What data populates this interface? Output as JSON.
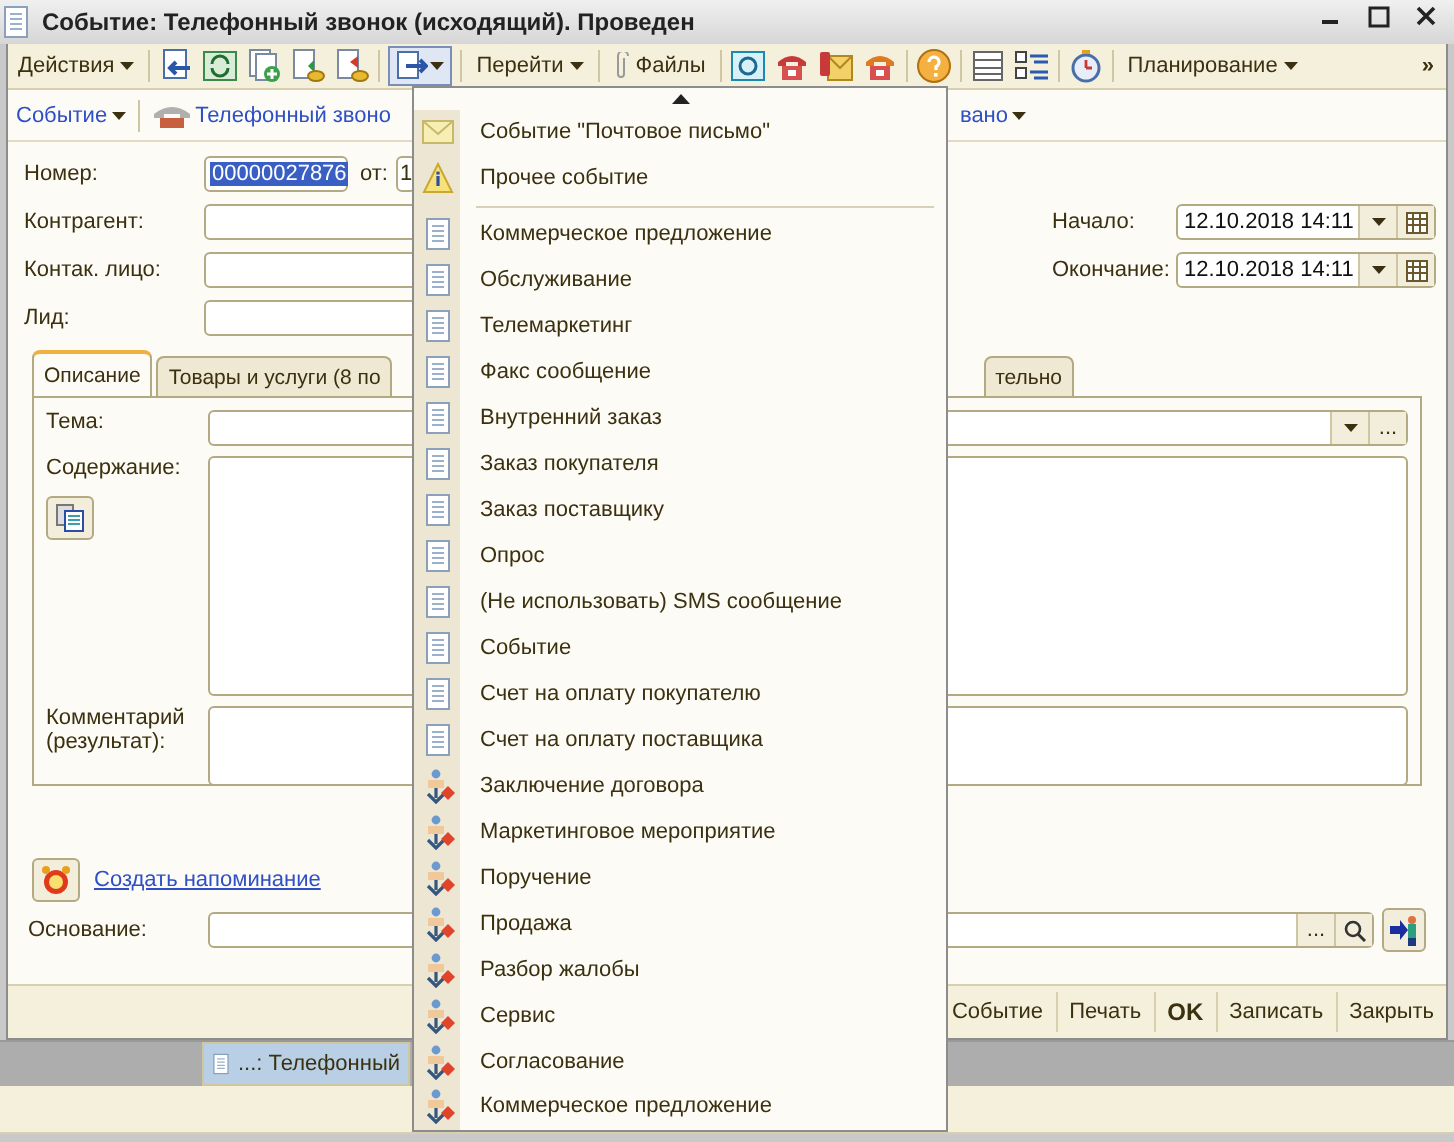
{
  "window": {
    "title": "Событие: Телефонный звонок (исходящий). Проведен"
  },
  "toolbar": {
    "actions": "Действия",
    "goto": "Перейти",
    "files": "Файлы",
    "planning": "Планирование",
    "more": "»",
    "create_based_pressed": true
  },
  "subbar": {
    "event": "Событие",
    "phone_event": "Телефонный звоно",
    "status": "вано"
  },
  "form": {
    "number_label": "Номер:",
    "number_value": "00000027876",
    "number_selected": true,
    "date_label": "от:",
    "date_value": "1",
    "counterparty_label": "Контрагент:",
    "contact_label": "Контак. лицо:",
    "lead_label": "Лид:",
    "start_label": "Начало:",
    "start_value": "12.10.2018 14:11",
    "end_label": "Окончание:",
    "end_value": "12.10.2018 14:11"
  },
  "tabs": [
    {
      "label": "Описание",
      "selected": true
    },
    {
      "label": "Товары и услуги (8 по",
      "selected": false
    },
    {
      "label": "тельно",
      "selected": false
    }
  ],
  "description": {
    "topic_label": "Тема:",
    "topic_choose": "...",
    "content_label": "Содержание:",
    "comment_label": "Комментарий (результат):"
  },
  "reminder_link": "Создать напоминание",
  "basis_label": "Основание:",
  "basis_choose": "...",
  "buttons": [
    {
      "label": "Событие",
      "default": false
    },
    {
      "label": "Печать",
      "default": false
    },
    {
      "label": "OK",
      "default": true
    },
    {
      "label": "Записать",
      "default": false
    },
    {
      "label": "Закрыть",
      "default": false
    }
  ],
  "taskbar": {
    "tab": "...: Телефонный",
    "selected": true
  },
  "menu": {
    "items": [
      {
        "kind": "mail",
        "label": "Событие \"Почтовое письмо\""
      },
      {
        "kind": "info",
        "label": "Прочее событие"
      },
      {
        "kind": "separator"
      },
      {
        "kind": "document",
        "label": "Коммерческое предложение"
      },
      {
        "kind": "document",
        "label": "Обслуживание"
      },
      {
        "kind": "document",
        "label": "Телемаркетинг"
      },
      {
        "kind": "document",
        "label": "Факс сообщение"
      },
      {
        "kind": "document",
        "label": "Внутренний заказ"
      },
      {
        "kind": "document",
        "label": "Заказ покупателя"
      },
      {
        "kind": "document",
        "label": "Заказ поставщику"
      },
      {
        "kind": "document",
        "label": "Опрос"
      },
      {
        "kind": "document",
        "label": "(Не использовать) SMS сообщение"
      },
      {
        "kind": "document",
        "label": "Событие"
      },
      {
        "kind": "document",
        "label": "Счет на оплату покупателю"
      },
      {
        "kind": "document",
        "label": "Счет на оплату поставщика"
      },
      {
        "kind": "process",
        "label": "Заключение договора"
      },
      {
        "kind": "process",
        "label": "Маркетинговое мероприятие"
      },
      {
        "kind": "process",
        "label": "Поручение"
      },
      {
        "kind": "process",
        "label": "Продажа"
      },
      {
        "kind": "process",
        "label": "Разбор жалобы"
      },
      {
        "kind": "process",
        "label": "Сервис"
      },
      {
        "kind": "process",
        "label": "Согласование"
      },
      {
        "kind": "process",
        "label": "Коммерческое предложение"
      }
    ]
  }
}
